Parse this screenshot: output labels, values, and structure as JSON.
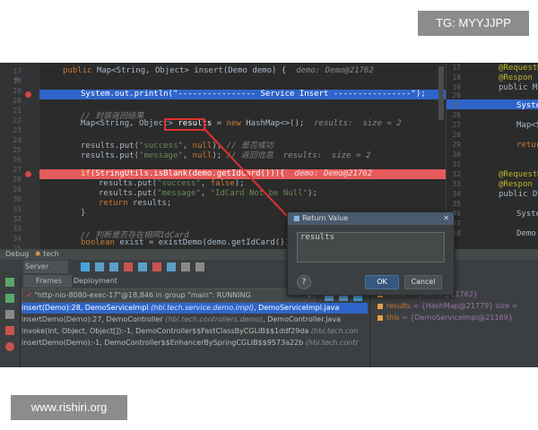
{
  "watermarks": {
    "top": "TG: MYYJJPP",
    "bottom": "www.rishiri.org"
  },
  "editor": {
    "lines": [
      {
        "num": "17"
      },
      {
        "num": "18"
      },
      {
        "num": "19"
      },
      {
        "num": "20"
      },
      {
        "num": "21"
      },
      {
        "num": "22"
      },
      {
        "num": "23"
      },
      {
        "num": "24"
      },
      {
        "num": "25"
      },
      {
        "num": "26"
      },
      {
        "num": "27"
      },
      {
        "num": "28"
      },
      {
        "num": "29"
      },
      {
        "num": "30"
      },
      {
        "num": "31"
      },
      {
        "num": "32"
      },
      {
        "num": "33"
      },
      {
        "num": "34"
      },
      {
        "num": "35"
      }
    ],
    "l18_kw": "public ",
    "l18_text": "Map<String, Object> insert(Demo demo) {",
    "l18_hint": "  demo: Demo@21762",
    "l19_text": "System.out.println(",
    "l19_str": "\"---------------- Service Insert ----------------\"",
    "l19_end": ");",
    "l22_cm": "// 封装返回结果",
    "l23_pre": "Map<String, Object> ",
    "l23_var": "results",
    "l23_mid": " = ",
    "l23_kw": "new ",
    "l23_post": "HashMap<>();",
    "l23_hint": "  results:  size = 2",
    "l25_pre": "results.put(",
    "l25_str": "\"success\"",
    "l25_mid": ", ",
    "l25_kw": "null",
    "l25_end": "); ",
    "l25_cm": "// 是否成功",
    "l26_pre": "results.put(",
    "l26_str": "\"message\"",
    "l26_mid": ", ",
    "l26_kw": "null",
    "l26_end": "); ",
    "l26_cm": "// 返回信息",
    "l26_hint": "  results:  size = 2",
    "l28_kw": "if",
    "l28_text": "(StringUtils.isBlank(demo.getIdCard())){",
    "l28_hint": "  demo: Demo@21762",
    "l29_pre": "results.put(",
    "l29_str": "\"success\"",
    "l29_mid": ", ",
    "l29_kw": "false",
    "l29_end": ");",
    "l30_pre": "results.put(",
    "l30_str": "\"message\"",
    "l30_mid": ", ",
    "l30_str2": "\"IdCard Not be Null\"",
    "l30_end": ");",
    "l31_kw": "return ",
    "l31_text": "results;",
    "l32_text": "}",
    "l34_cm": "// 判断是否存在相同IdCard",
    "l35_kw": "boolean ",
    "l35_text": "exist = existDemo(demo.getIdCard());"
  },
  "right_panel": {
    "lines": [
      {
        "num": "17",
        "text": "@RequestM"
      },
      {
        "num": "18",
        "text": "@Respon"
      },
      {
        "num": "19",
        "text": "public Ma"
      },
      {
        "num": "20",
        "text": ""
      },
      {
        "num": "25",
        "text": "Syste"
      },
      {
        "num": "26",
        "text": ""
      },
      {
        "num": "27",
        "text": "Map<S"
      },
      {
        "num": "28",
        "text": ""
      },
      {
        "num": "29",
        "text": "retur"
      },
      {
        "num": "30",
        "text": ""
      },
      {
        "num": "31",
        "text": ""
      },
      {
        "num": "32",
        "text": "@RequestM"
      },
      {
        "num": "33",
        "text": "@Respon"
      },
      {
        "num": "34",
        "text": "public De"
      },
      {
        "num": "35",
        "text": ""
      },
      {
        "num": "36",
        "text": "Syste"
      },
      {
        "num": "37",
        "text": ""
      },
      {
        "num": "38",
        "text": "Demo"
      }
    ]
  },
  "debug": {
    "title": "Debug",
    "run_config": "tech",
    "server_tab": "Server",
    "frames_tab": "Frames",
    "deployment_tab": "Deployment",
    "thread": "\"http-nio-8080-exec-17\"@18,846 in group \"main\": RUNNING",
    "frames": [
      {
        "method": "insert(Demo):28, DemoServiceImpl",
        "cls": " (hbi.tech.service.demo.impl)",
        "file": ", DemoServiceImpl.java"
      },
      {
        "method": "insertDemo(Demo):27, DemoController",
        "cls": " (hbi.tech.controllers.demo)",
        "file": ", DemoController.java"
      },
      {
        "method": "invoke(int, Object, Object[]):-1, DemoController$$FastClassByCGLIB$$1ddf29da",
        "cls": " (hbi.tech.con",
        "file": ""
      },
      {
        "method": "insertDemo(Demo):-1, DemoController$$EnhancerBySpringCGLIB$$9573a22b",
        "cls": " (hbi.tech.contr",
        "file": ""
      }
    ],
    "vars": [
      {
        "name": "demo",
        "value": " = {Demo@21762}"
      },
      {
        "name": "results",
        "value": " = {HashMap@21779}  size ="
      },
      {
        "name": "this",
        "value": " = {DemoServiceImpl@21169}"
      }
    ]
  },
  "dialog": {
    "title": "Return Value",
    "value": "results",
    "help": "?",
    "ok": "OK",
    "cancel": "Cancel"
  },
  "colors": {
    "keyword": "#cc7832",
    "string": "#6a8759",
    "comment": "#808080",
    "selection": "#2f65ca",
    "breakpoint": "#e55b5b",
    "annotation": "#e03030"
  }
}
